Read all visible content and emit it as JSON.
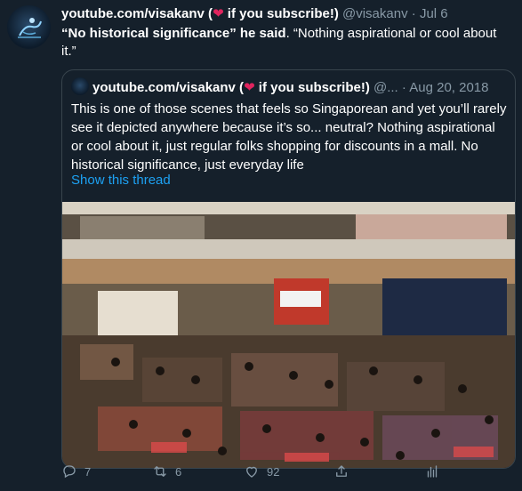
{
  "tweet": {
    "name": "youtube.com/visakanv (",
    "heart": "❤",
    "name_suffix": " if you subscribe!)",
    "handle": "@visakanv",
    "separator": " · ",
    "date": "Jul 6",
    "text_bold": "“No historical significance” he said",
    "text_rest": ". “Nothing aspirational or cool about it.”"
  },
  "quote": {
    "name": "youtube.com/visakanv (",
    "heart": "❤",
    "name_suffix": " if you subscribe!)",
    "handle": "@...",
    "separator": " · ",
    "date": "Aug 20, 2018",
    "text": "This is one of those scenes that feels so Singaporean and yet you’ll rarely see it depicted anywhere because it’s so... neutral? Nothing aspirational or cool about it, just regular folks shopping for discounts in a mall. No historical significance, just everyday life",
    "show_thread": "Show this thread"
  },
  "actions": {
    "reply_count": "7",
    "retweet_count": "6",
    "like_count": "92"
  },
  "colors": {
    "background": "#15202b",
    "accent": "#1da1f2",
    "muted": "#8899a6",
    "heart": "#e0245e",
    "border": "#38444d"
  },
  "icons": [
    "avatar",
    "heart-emoji",
    "reply-icon",
    "retweet-icon",
    "like-icon",
    "share-icon",
    "analytics-icon"
  ]
}
